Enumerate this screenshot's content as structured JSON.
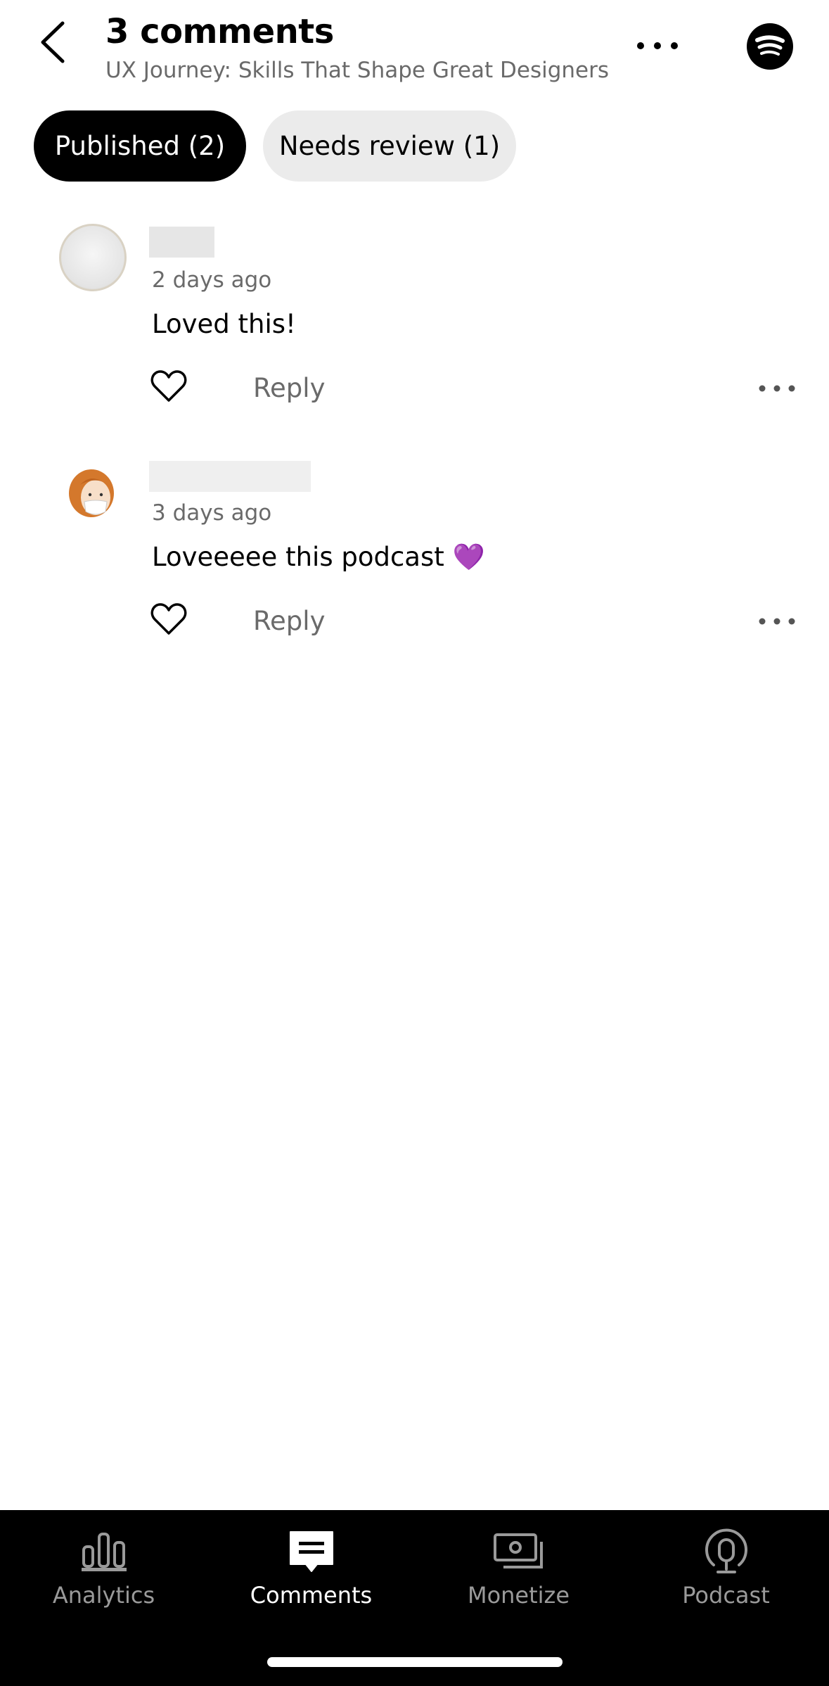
{
  "header": {
    "title": "3 comments",
    "subtitle": "UX Journey: Skills That Shape Great Designers",
    "back_icon": "chevron-left-icon",
    "more_icon": "more-horizontal-icon",
    "logo_icon": "spotify-logo-icon"
  },
  "tabs": [
    {
      "label": "Published (2)",
      "selected": true
    },
    {
      "label": "Needs review (1)",
      "selected": false
    }
  ],
  "comments": [
    {
      "time": "2 days ago",
      "text": "Loved this!",
      "reply_label": "Reply"
    },
    {
      "time": "3 days ago",
      "text": "Loveeeee this podcast 💜",
      "reply_label": "Reply"
    }
  ],
  "bottom_nav": [
    {
      "label": "Analytics",
      "icon": "bar-chart-icon",
      "active": false
    },
    {
      "label": "Comments",
      "icon": "comment-icon",
      "active": true
    },
    {
      "label": "Monetize",
      "icon": "money-icon",
      "active": false
    },
    {
      "label": "Podcast",
      "icon": "podcast-icon",
      "active": false
    }
  ],
  "colors": {
    "background": "#ffffff",
    "text_primary": "#000000",
    "text_secondary": "#6a6a6a",
    "tab_selected_bg": "#000000",
    "tab_unselected_bg": "#ebebeb",
    "nav_bg": "#000000",
    "nav_inactive": "#9a9a9a"
  }
}
